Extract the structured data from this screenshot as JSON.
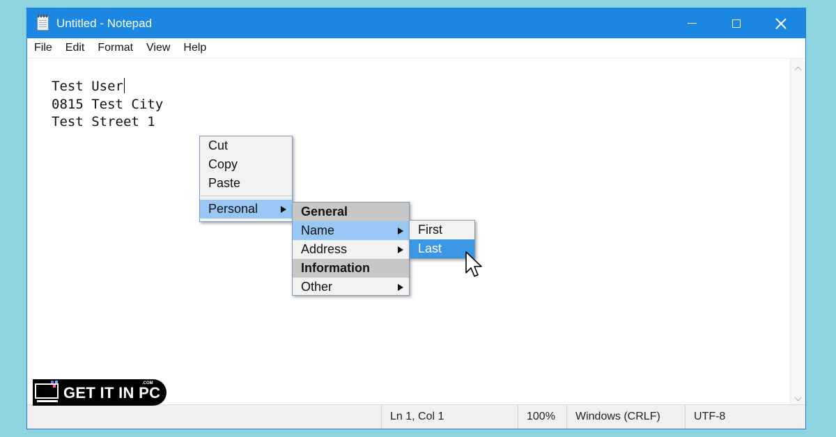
{
  "window": {
    "title": "Untitled - Notepad"
  },
  "menubar": {
    "items": [
      "File",
      "Edit",
      "Format",
      "View",
      "Help"
    ]
  },
  "editor": {
    "lines": [
      "Test User",
      "0815 Test City",
      "Test Street 1"
    ]
  },
  "context_menu": {
    "items": [
      "Cut",
      "Copy",
      "Paste"
    ],
    "submenu_label": "Personal"
  },
  "personal_menu": {
    "general_header": "General",
    "name_item": "Name",
    "address_item": "Address",
    "information_header": "Information",
    "other_item": "Other"
  },
  "name_menu": {
    "first_item": "First",
    "last_item": "Last"
  },
  "statusbar": {
    "position": "Ln 1, Col 1",
    "zoom": "100%",
    "line_endings": "Windows (CRLF)",
    "encoding": "UTF-8"
  },
  "watermark": {
    "text": "GET IT IN PC",
    "suffix": ".COM"
  },
  "colors": {
    "titlebar": "#1c87e0",
    "background": "#8ed3e0",
    "menu_highlight_light": "#99c7f5",
    "menu_highlight_strong": "#3c96e6"
  }
}
